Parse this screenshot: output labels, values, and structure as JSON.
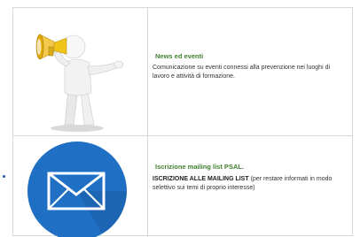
{
  "items": [
    {
      "title": "News ed eventi",
      "description": "Comunicazione su eventi connessi alla prevenzione nei luoghi di lavoro e attività di formazione.",
      "image_icon": "megaphone-person-icon"
    },
    {
      "title": "Iscrizione mailing list PSAL.",
      "description_bold": "ISCRIZIONE ALLE MAILING LIST",
      "description_rest": " (per restare informati in modo selettivo sui temi di proprio interesse)",
      "image_icon": "envelope-icon"
    }
  ],
  "colors": {
    "title_green": "#3f7f2f",
    "envelope_circle": "#1f6fc4",
    "border": "#d8d8d8"
  }
}
